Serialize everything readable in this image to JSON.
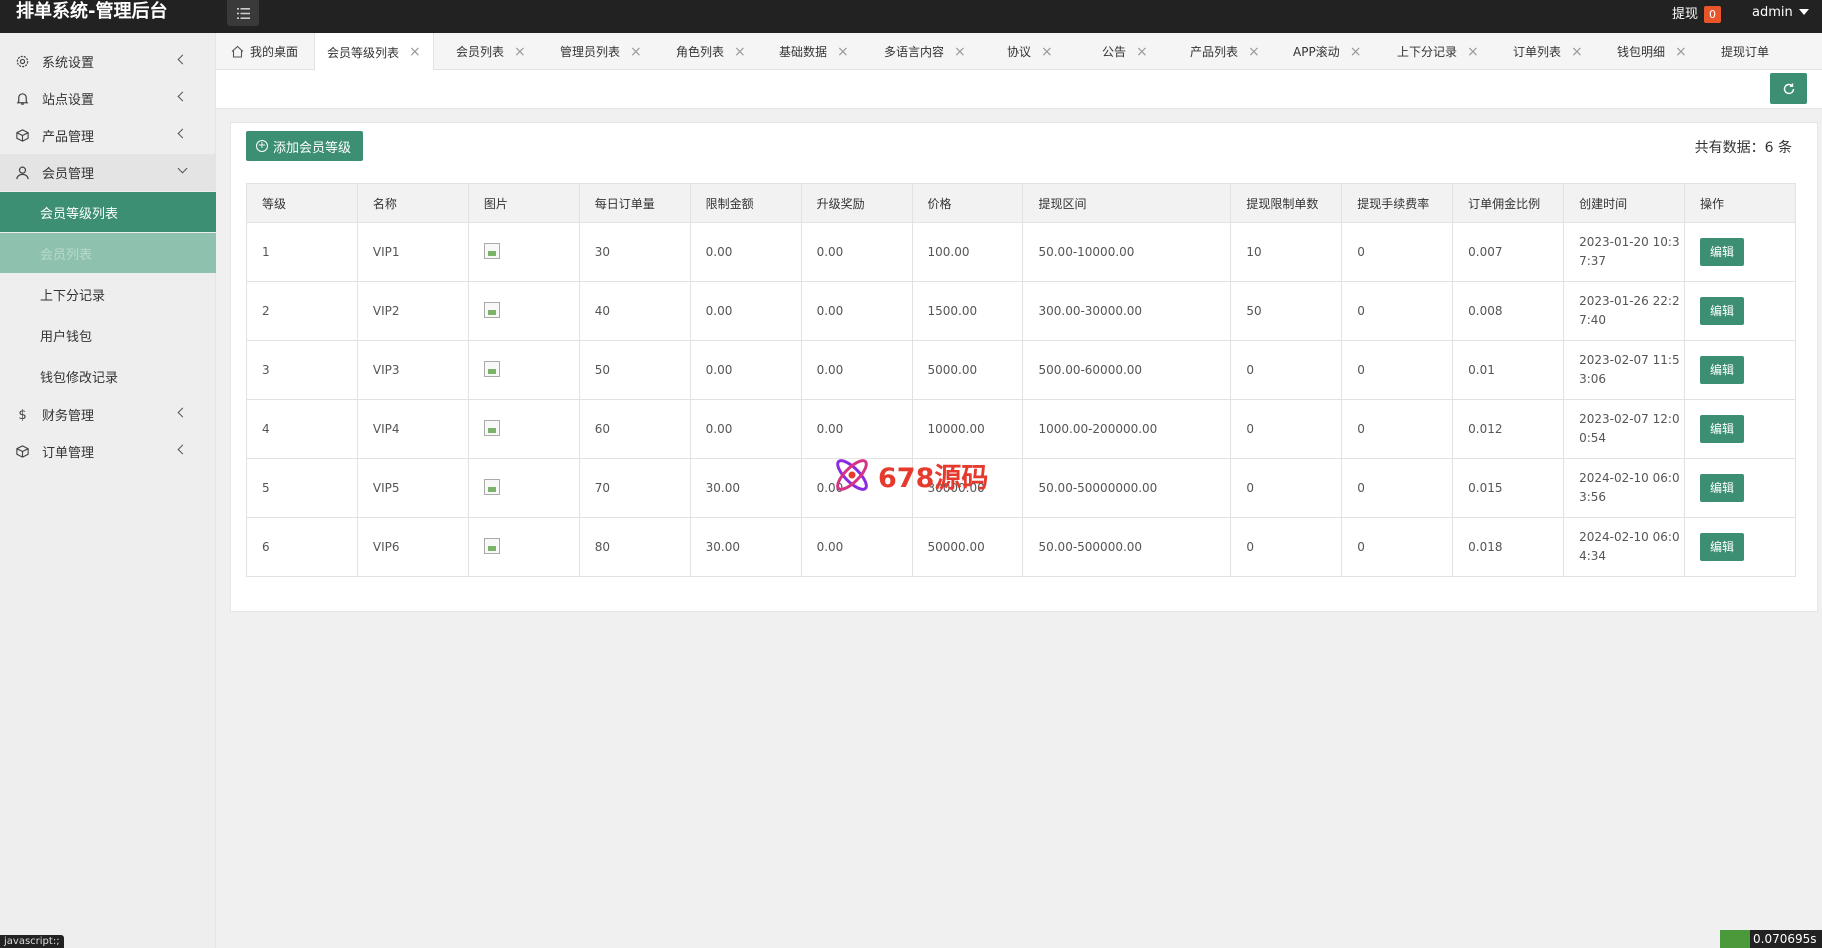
{
  "app": {
    "title": "排单系统-管理后台",
    "withdraw_label": "提现",
    "withdraw_count": "0",
    "user": "admin"
  },
  "sidebar": {
    "items": [
      {
        "label": "系统设置",
        "icon": "gear-icon"
      },
      {
        "label": "站点设置",
        "icon": "bell-icon"
      },
      {
        "label": "产品管理",
        "icon": "box-icon"
      },
      {
        "label": "会员管理",
        "icon": "user-icon",
        "expanded": true
      },
      {
        "label": "财务管理",
        "icon": "dollar-icon"
      },
      {
        "label": "订单管理",
        "icon": "box-icon"
      }
    ],
    "member_sub": [
      {
        "label": "会员等级列表",
        "state": "active"
      },
      {
        "label": "会员列表",
        "state": "hover"
      },
      {
        "label": "上下分记录"
      },
      {
        "label": "用户钱包"
      },
      {
        "label": "钱包修改记录"
      }
    ]
  },
  "tabs": [
    {
      "label": "我的桌面",
      "icon": "home-icon"
    },
    {
      "label": "会员等级列表",
      "active": true
    },
    {
      "label": "会员列表"
    },
    {
      "label": "管理员列表"
    },
    {
      "label": "角色列表"
    },
    {
      "label": "基础数据"
    },
    {
      "label": "多语言内容"
    },
    {
      "label": "协议"
    },
    {
      "label": "公告"
    },
    {
      "label": "产品列表"
    },
    {
      "label": "APP滚动"
    },
    {
      "label": "上下分记录"
    },
    {
      "label": "订单列表"
    },
    {
      "label": "钱包明细"
    },
    {
      "label": "提现订单"
    }
  ],
  "toolbar": {
    "add_label": "添加会员等级",
    "total_text": "共有数据：6 条"
  },
  "table": {
    "columns": [
      "等级",
      "名称",
      "图片",
      "每日订单量",
      "限制金额",
      "升级奖励",
      "价格",
      "提现区间",
      "提现限制单数",
      "提现手续费率",
      "订单佣金比例",
      "创建时间",
      "操作"
    ],
    "edit_label": "编辑",
    "rows": [
      {
        "level": "1",
        "name": "VIP1",
        "daily": "30",
        "limit": "0.00",
        "reward": "0.00",
        "price": "100.00",
        "range": "50.00-10000.00",
        "wlimit": "10",
        "fee": "0",
        "commission": "0.007",
        "time1": "2023-01-20 10:3",
        "time2": "7:37"
      },
      {
        "level": "2",
        "name": "VIP2",
        "daily": "40",
        "limit": "0.00",
        "reward": "0.00",
        "price": "1500.00",
        "range": "300.00-30000.00",
        "wlimit": "50",
        "fee": "0",
        "commission": "0.008",
        "time1": "2023-01-26 22:2",
        "time2": "7:40"
      },
      {
        "level": "3",
        "name": "VIP3",
        "daily": "50",
        "limit": "0.00",
        "reward": "0.00",
        "price": "5000.00",
        "range": "500.00-60000.00",
        "wlimit": "0",
        "fee": "0",
        "commission": "0.01",
        "time1": "2023-02-07 11:5",
        "time2": "3:06"
      },
      {
        "level": "4",
        "name": "VIP4",
        "daily": "60",
        "limit": "0.00",
        "reward": "0.00",
        "price": "10000.00",
        "range": "1000.00-200000.00",
        "wlimit": "0",
        "fee": "0",
        "commission": "0.012",
        "time1": "2023-02-07 12:0",
        "time2": "0:54"
      },
      {
        "level": "5",
        "name": "VIP5",
        "daily": "70",
        "limit": "30.00",
        "reward": "0.00",
        "price": "30000.00",
        "range": "50.00-50000000.00",
        "wlimit": "0",
        "fee": "0",
        "commission": "0.015",
        "time1": "2024-02-10 06:0",
        "time2": "3:56"
      },
      {
        "level": "6",
        "name": "VIP6",
        "daily": "80",
        "limit": "30.00",
        "reward": "0.00",
        "price": "50000.00",
        "range": "50.00-500000.00",
        "wlimit": "0",
        "fee": "0",
        "commission": "0.018",
        "time1": "2024-02-10 06:0",
        "time2": "4:34"
      }
    ]
  },
  "watermark": {
    "text": "678源码"
  },
  "status": {
    "js": "javascript:;",
    "timer": "0.070695s"
  },
  "colors": {
    "accent": "#3c8f73",
    "header": "#222222",
    "badge": "#e8552a",
    "watermark": "#e63a2e"
  }
}
